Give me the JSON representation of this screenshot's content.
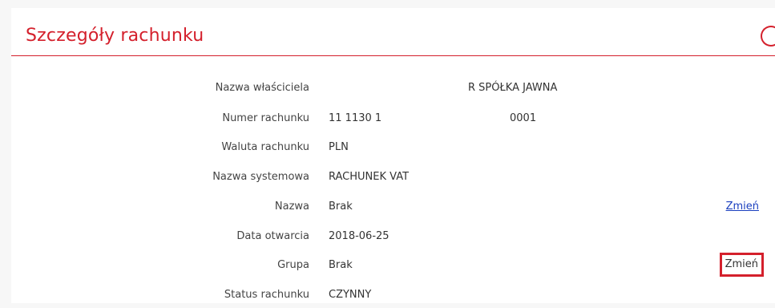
{
  "header": {
    "title": "Szczegóły rachunku"
  },
  "details": [
    {
      "label": "Nazwa właściciela",
      "value": "R SPÓŁKA JAWNA"
    },
    {
      "label": "Numer rachunku",
      "value_prefix": "11 1130 1",
      "value_suffix": "0001"
    },
    {
      "label": "Waluta rachunku",
      "value": "PLN"
    },
    {
      "label": "Nazwa systemowa",
      "value": "RACHUNEK VAT"
    },
    {
      "label": "Nazwa",
      "value": "Brak",
      "action": "Zmień"
    },
    {
      "label": "Data otwarcia",
      "value": "2018-06-25"
    },
    {
      "label": "Grupa",
      "value": "Brak",
      "action": "Zmień"
    },
    {
      "label": "Status rachunku",
      "value": "CZYNNY"
    }
  ],
  "colors": {
    "accent": "#d4202c",
    "link": "#1a3fbf"
  }
}
